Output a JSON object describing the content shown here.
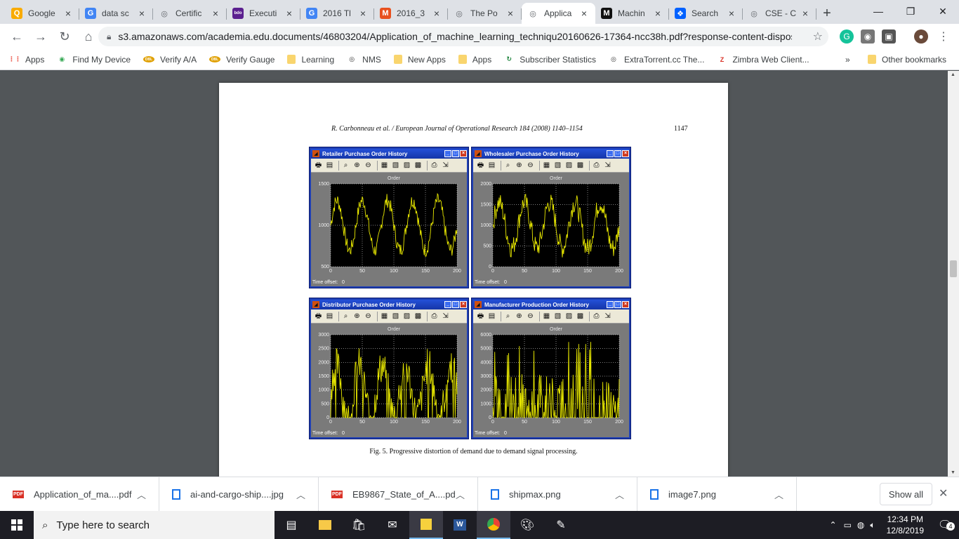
{
  "tabs": [
    {
      "label": "Google",
      "icon": "bulb-icon",
      "color": "#f9ab00",
      "glyph": "Q"
    },
    {
      "label": "data sc",
      "icon": "google-icon",
      "color": "#4285f4",
      "glyph": "G"
    },
    {
      "label": "Certific",
      "icon": "globe-icon",
      "color": "#5f6368",
      "glyph": "◎"
    },
    {
      "label": "Executi",
      "icon": "bdo-icon",
      "color": "#5b1f8f",
      "glyph": "bdo"
    },
    {
      "label": "2016 Tl",
      "icon": "google-icon",
      "color": "#4285f4",
      "glyph": "G"
    },
    {
      "label": "2016_3",
      "icon": "magento-icon",
      "color": "#e8501e",
      "glyph": "M"
    },
    {
      "label": "The Po",
      "icon": "globe-icon",
      "color": "#5f6368",
      "glyph": "◎"
    },
    {
      "label": "Applica",
      "icon": "globe-icon",
      "color": "#5f6368",
      "glyph": "◎",
      "active": true
    },
    {
      "label": "Machin",
      "icon": "medium-icon",
      "color": "#111111",
      "glyph": "M"
    },
    {
      "label": "Search",
      "icon": "dropbox-icon",
      "color": "#0061ff",
      "glyph": "❖"
    },
    {
      "label": "CSE - C",
      "icon": "globe-icon",
      "color": "#5f6368",
      "glyph": "◎"
    }
  ],
  "url": "s3.amazonaws.com/academia.edu.documents/46803204/Application_of_machine_learning_techniqu20160626-17364-ncc38h.pdf?response-content-disposi...",
  "bookmarks": [
    {
      "label": "Apps",
      "icon": "apps-grid-icon"
    },
    {
      "label": "Find My Device",
      "icon": "find-device-icon"
    },
    {
      "label": "Verify A/A",
      "icon": "dbl-icon"
    },
    {
      "label": "Verify Gauge",
      "icon": "dbl-icon"
    },
    {
      "label": "Learning",
      "icon": "folder-icon"
    },
    {
      "label": "NMS",
      "icon": "globe-icon"
    },
    {
      "label": "New Apps",
      "icon": "folder-icon"
    },
    {
      "label": "Apps",
      "icon": "folder-icon"
    },
    {
      "label": "Subscriber Statistics",
      "icon": "stats-icon"
    },
    {
      "label": "ExtraTorrent.cc The...",
      "icon": "globe-icon"
    },
    {
      "label": "Zimbra Web Client...",
      "icon": "zimbra-icon"
    }
  ],
  "bookmarks_more": "»",
  "other_bookmarks": "Other bookmarks",
  "pdf": {
    "running_header": "R. Carbonneau et al. / European Journal of Operational Research 184 (2008) 1140–1154",
    "page_number": "1147",
    "caption": "Fig. 5.  Progressive distortion of demand due to demand signal processing."
  },
  "plots": [
    {
      "window_title": "Retailer Purchase  Order History",
      "plot_title": "Order",
      "yticks": [
        "1500",
        "1000",
        "500"
      ],
      "ymin": 500,
      "ymax": 1500,
      "xticks": [
        "0",
        "50",
        "100",
        "150",
        "200"
      ],
      "time_offset_label": "Time offset:",
      "time_offset_value": "0",
      "kind": "retailer"
    },
    {
      "window_title": "Wholesaler Purchase Order History",
      "plot_title": "Order",
      "yticks": [
        "2000",
        "1500",
        "1000",
        "500",
        "0"
      ],
      "ymin": 0,
      "ymax": 2000,
      "xticks": [
        "0",
        "50",
        "100",
        "150",
        "200"
      ],
      "time_offset_label": "Time offset:",
      "time_offset_value": "0",
      "kind": "wholesaler"
    },
    {
      "window_title": "Distributor Purchase Order History",
      "plot_title": "Order",
      "yticks": [
        "3000",
        "2500",
        "2000",
        "1500",
        "1000",
        "500",
        "0"
      ],
      "ymin": 0,
      "ymax": 3000,
      "xticks": [
        "0",
        "50",
        "100",
        "150",
        "200"
      ],
      "time_offset_label": "Time offset:",
      "time_offset_value": "0",
      "kind": "distributor"
    },
    {
      "window_title": "Manufacturer Production Order History",
      "plot_title": "Order",
      "yticks": [
        "6000",
        "5000",
        "4000",
        "3000",
        "2000",
        "1000",
        "0"
      ],
      "ymin": 0,
      "ymax": 6000,
      "xticks": [
        "0",
        "50",
        "100",
        "150",
        "200"
      ],
      "time_offset_label": "Time offset:",
      "time_offset_value": "0",
      "kind": "manufacturer"
    }
  ],
  "downloads": [
    {
      "name": "Application_of_ma....pdf",
      "icon": "pdf-icon"
    },
    {
      "name": "ai-and-cargo-ship....jpg",
      "icon": "image-icon"
    },
    {
      "name": "EB9867_State_of_A....pdf",
      "icon": "pdf-icon"
    },
    {
      "name": "shipmax.png",
      "icon": "image-icon"
    },
    {
      "name": "image7.png",
      "icon": "image-icon"
    }
  ],
  "show_all": "Show all",
  "taskbar": {
    "search_placeholder": "Type here to search",
    "time": "12:34 PM",
    "date": "12/8/2019",
    "notifications": "4"
  },
  "colors": {
    "plot_line": "#e8e800",
    "plot_bg": "#000000",
    "matlab_frame": "#1f3fb3"
  }
}
